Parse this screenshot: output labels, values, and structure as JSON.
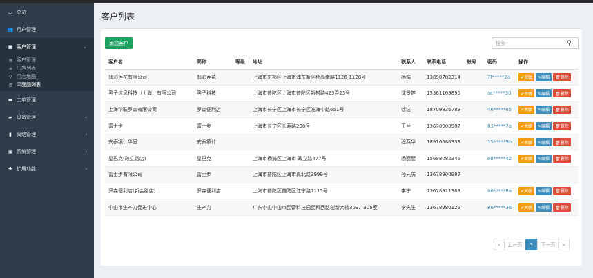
{
  "sidebar": {
    "items": [
      {
        "label": "总览",
        "icon": "dashboard-icon"
      },
      {
        "label": "用户管理",
        "icon": "users-icon"
      },
      {
        "label": "客户管理",
        "icon": "briefcase-icon",
        "open": true,
        "children": [
          {
            "label": "客户管理",
            "icon": "document-icon"
          },
          {
            "label": "门店列表",
            "icon": "list-icon"
          },
          {
            "label": "门店地图",
            "icon": "map-pin-icon"
          },
          {
            "label": "平面图列表",
            "icon": "image-icon"
          }
        ]
      },
      {
        "label": "工单管理",
        "icon": "ticket-icon"
      },
      {
        "label": "设备管理",
        "icon": "device-icon"
      },
      {
        "label": "策略管理",
        "icon": "file-icon"
      },
      {
        "label": "系统管理",
        "icon": "server-icon"
      },
      {
        "label": "扩展功能",
        "icon": "puzzle-icon"
      }
    ]
  },
  "page": {
    "title": "客户列表"
  },
  "toolbar": {
    "add_label": "添加客户",
    "search_placeholder": "搜索"
  },
  "table": {
    "headers": [
      "客户名",
      "简称",
      "等级",
      "地址",
      "联系人",
      "联系电话",
      "账号",
      "密码",
      "操作"
    ],
    "actions": {
      "follow": "✔关联",
      "edit": "✎编辑",
      "delete": "🗑删除"
    },
    "rows": [
      {
        "name": "翡彩莲花有限公司",
        "short": "翡彩莲花",
        "level": "",
        "address": "上海市东部区上海市浦东新区杨高南路1126-1128号",
        "contact": "杨娟",
        "phone": "13890782314",
        "account": "",
        "password": "7f*****2a",
        "actions": true
      },
      {
        "name": "黑子信息科技（上海）有限公司",
        "short": "黑子科技",
        "level": "",
        "address": "上海市普陀区上海市普陀区新村路423弄23号",
        "contact": "沈景婷",
        "phone": "15361169896",
        "account": "",
        "password": "ac*****30",
        "actions": true
      },
      {
        "name": "上海华联罗森有限公司",
        "short": "罗森便利店",
        "level": "",
        "address": "上海市长宁区上海市长宁区淮海中路651号",
        "contact": "徐洁",
        "phone": "18709836789",
        "account": "",
        "password": "46*****e5",
        "actions": true
      },
      {
        "name": "富士步",
        "short": "富士步",
        "level": "",
        "address": "上海市长宁区长寿路238号",
        "contact": "王兰",
        "phone": "13678900987",
        "account": "",
        "password": "83*****7a",
        "actions": true
      },
      {
        "name": "安泰镇什华庭",
        "short": "安泰镇什",
        "level": "",
        "address": "",
        "contact": "程燕华",
        "phone": "18916686333",
        "account": "",
        "password": "15*****9b",
        "actions": true
      },
      {
        "name": "星巴克(政立路店)",
        "short": "星巴克",
        "level": "",
        "address": "上海市杨浦区上海市 政立路477号",
        "contact": "杨丽丽",
        "phone": "15698082346",
        "account": "",
        "password": "e8*****42",
        "actions": true
      },
      {
        "name": "富士步有限公司",
        "short": "富士步",
        "level": "",
        "address": "上海市普陀区上海市真北路3999号",
        "contact": "孙元庆",
        "phone": "13678900987",
        "account": "",
        "password": "",
        "actions": false
      },
      {
        "name": "罗森便利店(新会路店)",
        "short": "罗森便利店",
        "level": "",
        "address": "上海市普陀区普陀区江宁路1115号",
        "contact": "李宁",
        "phone": "13678921389",
        "account": "",
        "password": "b6*****8a",
        "actions": true
      },
      {
        "name": "中山市生产力促进中心",
        "short": "生产力",
        "level": "",
        "address": "广东中山中山市民营科技园民科西路创新大楼303、305室",
        "contact": "李先生",
        "phone": "13678980125",
        "account": "",
        "password": "86*****36",
        "actions": true
      }
    ]
  },
  "pager": {
    "first": "«",
    "prev": "上一页",
    "current": "1",
    "next": "下一页",
    "last": "»"
  }
}
